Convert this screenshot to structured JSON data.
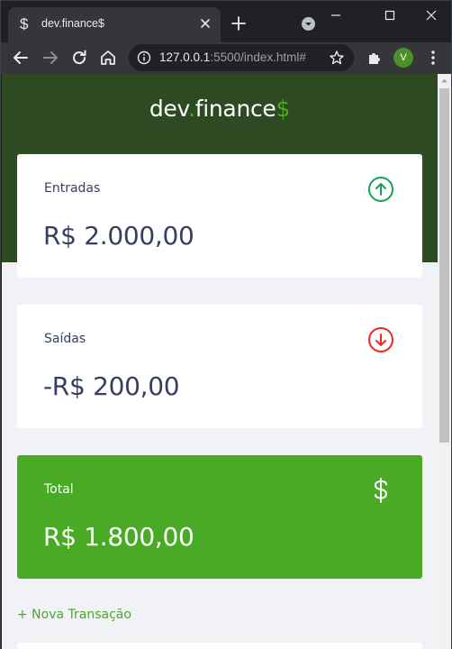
{
  "browser": {
    "tab_title": "dev.finance$",
    "tab_favicon": "$",
    "url_host": "127.0.0.1",
    "url_rest": ":5500/index.html#",
    "profile_initial": "V"
  },
  "page": {
    "logo": {
      "part1": "dev",
      "dot": ".",
      "part2": "finance",
      "dollar": "$"
    },
    "cards": {
      "income": {
        "label": "Entradas",
        "value": "R$ 2.000,00",
        "icon": "arrow-up-circle-icon",
        "icon_color": "#12a454"
      },
      "expense": {
        "label": "Saídas",
        "value": "-R$ 200,00",
        "icon": "arrow-down-circle-icon",
        "icon_color": "#e92929"
      },
      "total": {
        "label": "Total",
        "value": "R$ 1.800,00",
        "icon": "dollar-sign-icon",
        "background": "#49aa26"
      }
    },
    "new_transaction_link": "+ Nova Transação"
  },
  "colors": {
    "header_bg": "#2d4a22",
    "accent_green": "#49aa26",
    "page_bg": "#f0f2f5",
    "text_dark": "#363f5f"
  }
}
